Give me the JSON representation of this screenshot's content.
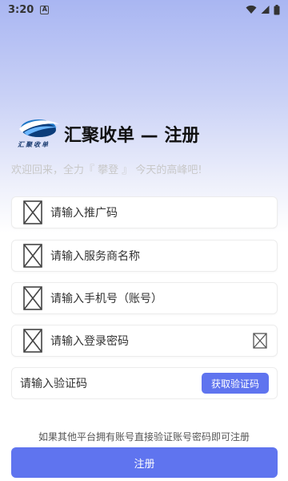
{
  "status_bar": {
    "time": "3:20",
    "notification_icon": "a-letter-icon",
    "right_icons": [
      "wifi-icon",
      "signal-icon",
      "battery-icon"
    ]
  },
  "brand": {
    "logo_icon": "swoosh-logo-icon",
    "logo_text": "汇聚收单",
    "title": "汇聚收单 — 注册"
  },
  "welcome": "欢迎回来，全力『 攀登 』 今天的高峰吧!",
  "fields": {
    "promo_code": {
      "placeholder": "请输入推广码",
      "icon": "broken-image-icon"
    },
    "merchant_name": {
      "placeholder": "请输入服务商名称",
      "icon": "broken-image-icon"
    },
    "phone": {
      "placeholder": "请输入手机号（账号）",
      "icon": "broken-image-icon"
    },
    "password": {
      "placeholder": "请输入登录密码",
      "icon": "broken-image-icon",
      "toggle_icon": "broken-image-icon"
    }
  },
  "verification": {
    "placeholder": "请输入验证码",
    "button_label": "获取验证码"
  },
  "hint": "如果其他平台拥有账号直接验证账号密码即可注册",
  "register_label": "注册",
  "colors": {
    "accent": "#5f74ef",
    "gradient_top": "#a9b6f2",
    "welcome_text": "#c8c8c8"
  }
}
